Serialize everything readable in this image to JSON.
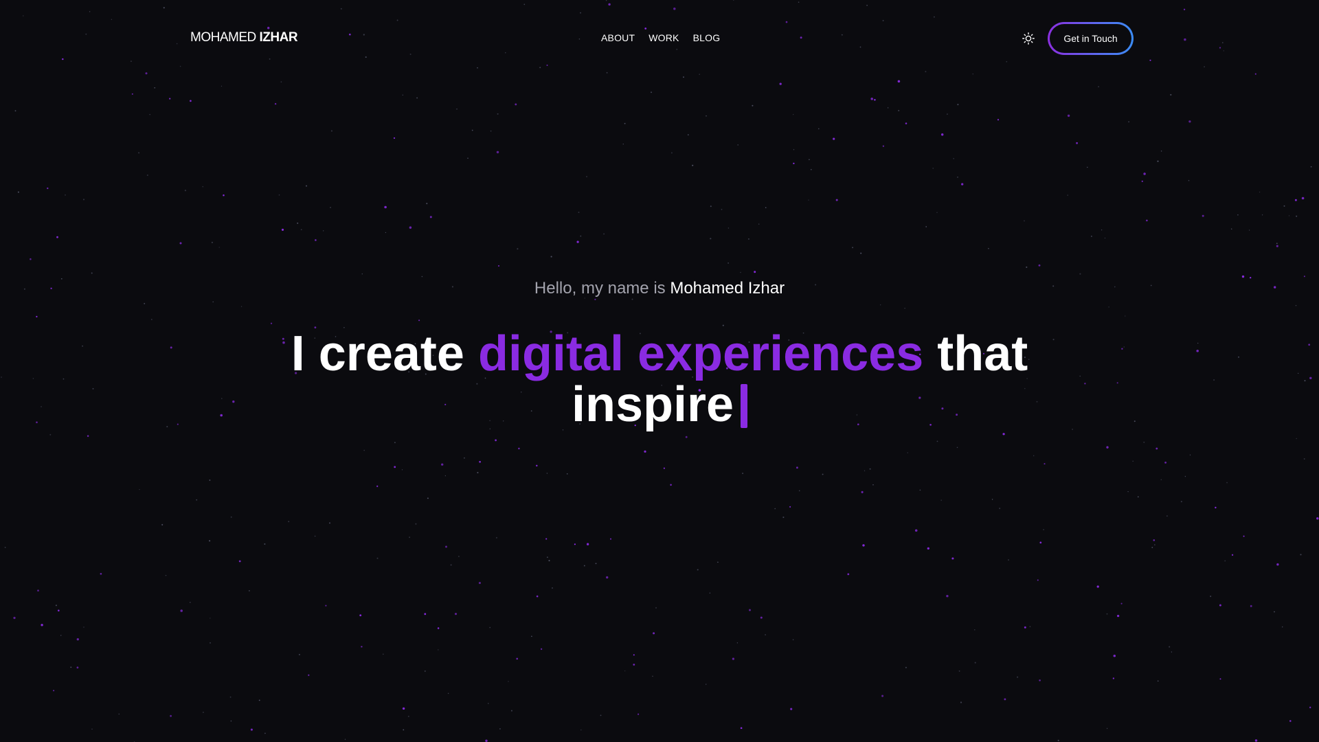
{
  "colors": {
    "background": "#0b0b0f",
    "accent": "#8a2be2",
    "star": "#8a2be2",
    "muted_text": "#a3a3ad",
    "cta_gradient_start": "#8b2fe0",
    "cta_gradient_end": "#3b8cf5"
  },
  "header": {
    "logo_first": "MOHAMED",
    "logo_last": "IZHAR",
    "nav": [
      {
        "label": "ABOUT"
      },
      {
        "label": "WORK"
      },
      {
        "label": "BLOG"
      }
    ],
    "theme_toggle_icon": "sun-icon",
    "cta_label": "Get in Touch"
  },
  "hero": {
    "greeting_prefix": "Hello, my name is",
    "greeting_name": "Mohamed Izhar",
    "headline_start": "I create",
    "headline_accent": "digital experiences",
    "headline_end_1": "that",
    "headline_end_2": "inspire"
  }
}
